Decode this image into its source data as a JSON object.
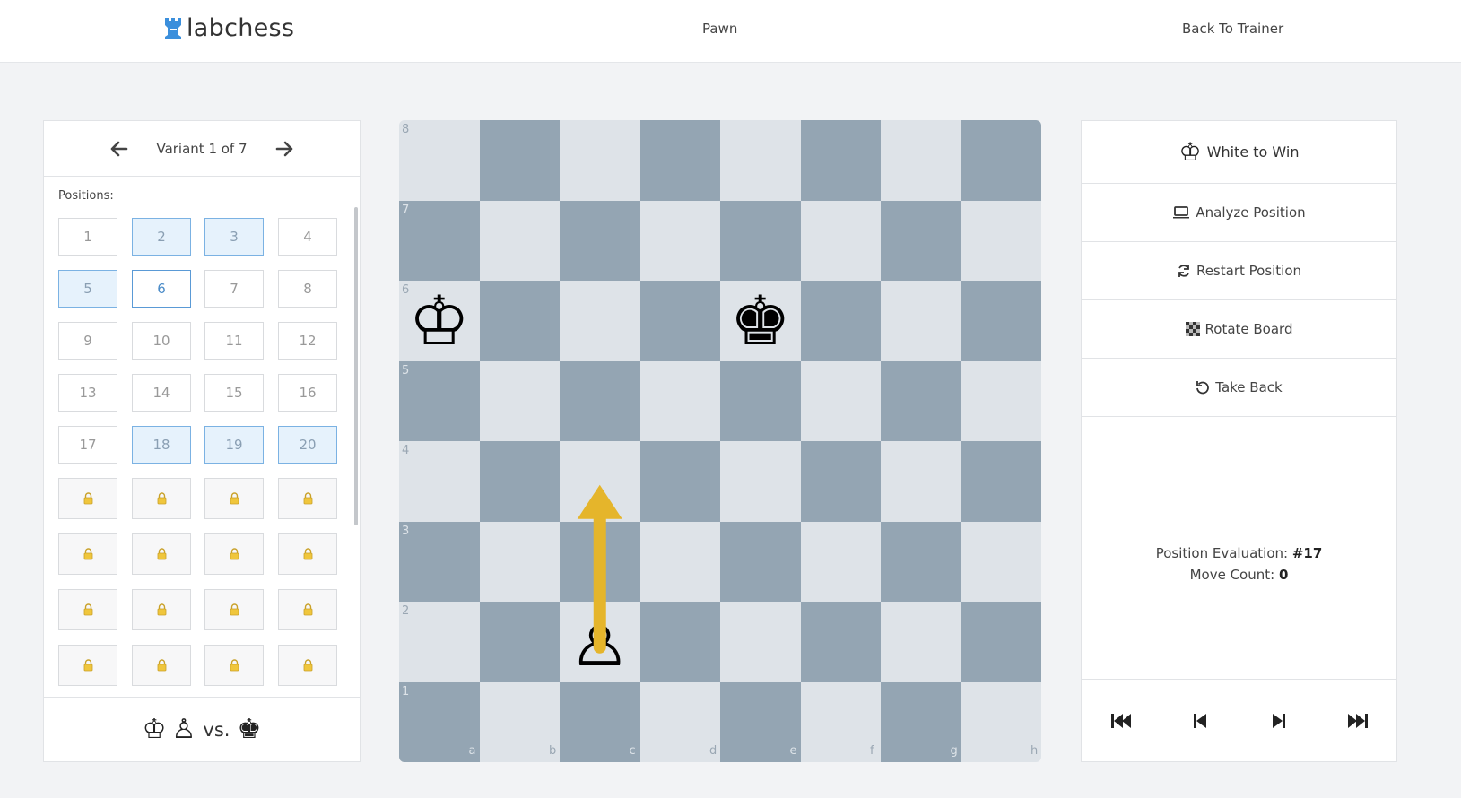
{
  "header": {
    "logo_text": "labchess",
    "title": "Pawn",
    "back_link": "Back To Trainer"
  },
  "variant": {
    "label": "Variant 1 of 7"
  },
  "positions": {
    "title": "Positions:",
    "unlocked": [
      {
        "n": "1",
        "state": "default"
      },
      {
        "n": "2",
        "state": "done"
      },
      {
        "n": "3",
        "state": "done"
      },
      {
        "n": "4",
        "state": "default"
      },
      {
        "n": "5",
        "state": "done"
      },
      {
        "n": "6",
        "state": "current"
      },
      {
        "n": "7",
        "state": "default"
      },
      {
        "n": "8",
        "state": "default"
      },
      {
        "n": "9",
        "state": "default"
      },
      {
        "n": "10",
        "state": "default"
      },
      {
        "n": "11",
        "state": "default"
      },
      {
        "n": "12",
        "state": "default"
      },
      {
        "n": "13",
        "state": "default"
      },
      {
        "n": "14",
        "state": "default"
      },
      {
        "n": "15",
        "state": "default"
      },
      {
        "n": "16",
        "state": "default"
      },
      {
        "n": "17",
        "state": "default"
      },
      {
        "n": "18",
        "state": "done"
      },
      {
        "n": "19",
        "state": "done"
      },
      {
        "n": "20",
        "state": "done"
      }
    ],
    "locked_count": 16,
    "lock_icon": "lock-icon"
  },
  "material": {
    "white": [
      "♔",
      "♙"
    ],
    "vs": "vs.",
    "black": [
      "♚"
    ]
  },
  "board": {
    "ranks": [
      "8",
      "7",
      "6",
      "5",
      "4",
      "3",
      "2",
      "1"
    ],
    "files": [
      "a",
      "b",
      "c",
      "d",
      "e",
      "f",
      "g",
      "h"
    ],
    "pieces": [
      {
        "square": "a6",
        "symbol": "♔",
        "name": "white-king"
      },
      {
        "square": "e6",
        "symbol": "♚",
        "name": "black-king"
      },
      {
        "square": "c2",
        "symbol": "♙",
        "name": "white-pawn"
      }
    ],
    "arrow": {
      "from": "c2",
      "to": "c4",
      "color": "#e5b52b"
    },
    "light_color": "#dee3e8",
    "dark_color": "#94a5b3"
  },
  "actions": {
    "objective": "White to Win",
    "analyze": "Analyze Position",
    "restart": "Restart Position",
    "rotate": "Rotate Board",
    "takeback": "Take Back"
  },
  "evaluation": {
    "label": "Position Evaluation:",
    "value": "#17",
    "moves_label": "Move Count:",
    "moves_value": "0"
  },
  "navigation": [
    "first-move-icon",
    "previous-move-icon",
    "next-move-icon",
    "last-move-icon"
  ]
}
